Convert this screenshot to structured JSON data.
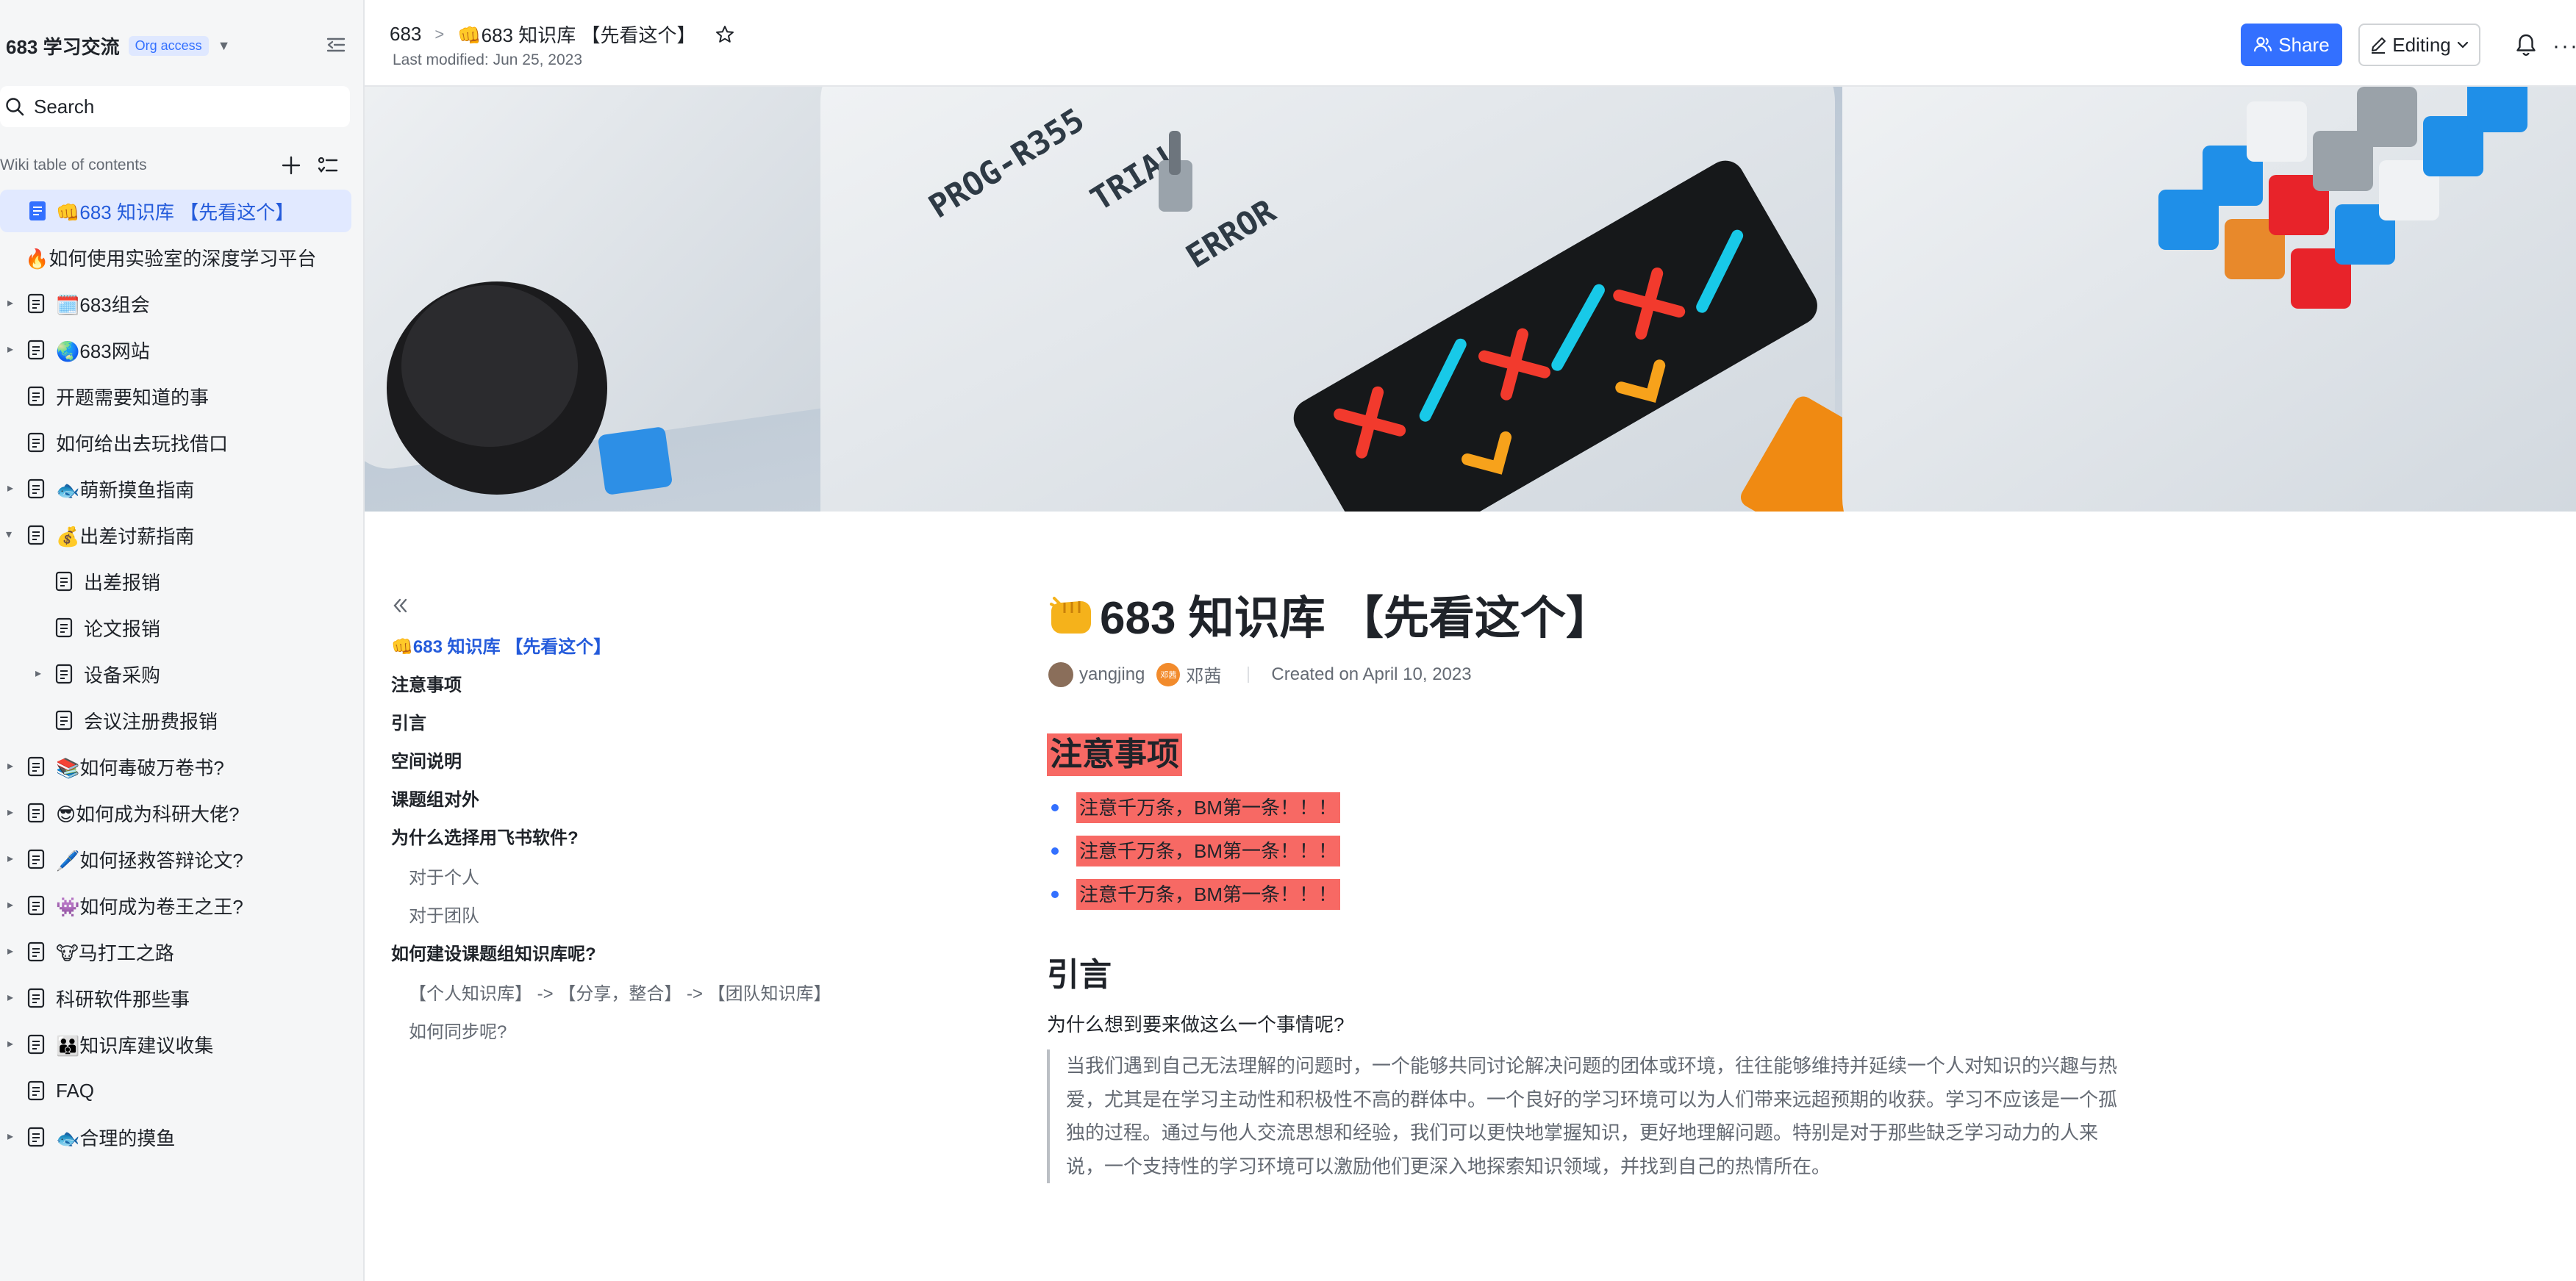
{
  "sidebar": {
    "space_name": "683 学习交流",
    "org_badge": "Org access",
    "search_placeholder": "Search",
    "toc_title": "Wiki table of contents",
    "items": [
      {
        "label": "👊683 知识库 【先看这个】",
        "active": true
      },
      {
        "label": "🔥如何使用实验室的深度学习平台"
      },
      {
        "label": "🗓️683组会"
      },
      {
        "label": "🌏683网站"
      },
      {
        "label": "开题需要知道的事"
      },
      {
        "label": "如何给出去玩找借口"
      },
      {
        "label": "🐟萌新摸鱼指南"
      },
      {
        "label": "💰出差讨薪指南"
      },
      {
        "label": "出差报销"
      },
      {
        "label": "论文报销"
      },
      {
        "label": "设备采购"
      },
      {
        "label": "会议注册费报销"
      },
      {
        "label": "📚如何毒破万卷书?"
      },
      {
        "label": "😎如何成为科研大佬?"
      },
      {
        "label": "🖊️如何拯救答辩论文?"
      },
      {
        "label": "👾如何成为卷王之王?"
      },
      {
        "label": "🐮马打工之路"
      },
      {
        "label": "科研软件那些事"
      },
      {
        "label": "👪知识库建议收集"
      },
      {
        "label": "FAQ"
      },
      {
        "label": "🐟合理的摸鱼"
      }
    ]
  },
  "header": {
    "breadcrumb_root": "683",
    "breadcrumb_current": "👊683 知识库 【先看这个】",
    "last_modified": "Last modified: Jun 25, 2023",
    "share_label": "Share",
    "editing_label": "Editing",
    "more_label": "···"
  },
  "banner": {
    "prog_text": "PROG-R355",
    "trial_text": "TRIAL",
    "error_text": "ERROR"
  },
  "toc": {
    "items": [
      {
        "label": "👊683 知识库 【先看这个】",
        "level": "current"
      },
      {
        "label": "注意事项",
        "level": "h1"
      },
      {
        "label": "引言",
        "level": "h1"
      },
      {
        "label": "空间说明",
        "level": "h1"
      },
      {
        "label": "课题组对外",
        "level": "h1"
      },
      {
        "label": "为什么选择用飞书软件?",
        "level": "h1"
      },
      {
        "label": "对于个人",
        "level": "h2"
      },
      {
        "label": "对于团队",
        "level": "h2"
      },
      {
        "label": "如何建设课题组知识库呢?",
        "level": "h1"
      },
      {
        "label": "【个人知识库】 -> 【分享，整合】 -> 【团队知识库】",
        "level": "h2"
      },
      {
        "label": "如何同步呢?",
        "level": "h2"
      }
    ]
  },
  "document": {
    "title": "683 知识库 【先看这个】",
    "author1": "yangjing",
    "author2_badge": "邓茜",
    "author2": "邓茜",
    "created": "Created on April 10, 2023",
    "section1_heading": "注意事项",
    "notes": [
      "注意千万条，BM第一条！！！",
      "注意千万条，BM第一条！！！",
      "注意千万条，BM第一条！！！"
    ],
    "section2_heading": "引言",
    "why_question": "为什么想到要来做这么一个事情呢?",
    "quote_text": "当我们遇到自己无法理解的问题时，一个能够共同讨论解决问题的团体或环境，往往能够维持并延续一个人对知识的兴趣与热爱，尤其是在学习主动性和积极性不高的群体中。一个良好的学习环境可以为人们带来远超预期的收获。学习不应该是一个孤独的过程。通过与他人交流思想和经验，我们可以更快地掌握知识，更好地理解问题。特别是对于那些缺乏学习动力的人来说，一个支持性的学习环境可以激励他们更深入地探索知识领域，并找到自己的热情所在。"
  },
  "colors": {
    "accent": "#3370ff",
    "highlight": "#f76964",
    "active_bg": "#e1e9ff",
    "sidebar_bg": "#f5f6f7"
  }
}
